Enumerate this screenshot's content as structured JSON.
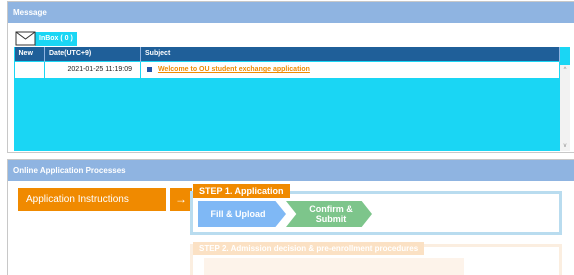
{
  "message": {
    "header": "Message",
    "inbox_label": "InBox ( 0 )",
    "columns": [
      "New",
      "Date(UTC+9)",
      "Subject"
    ],
    "rows": [
      {
        "new": "",
        "date": "2021-01-25 11:19:09",
        "subject": "Welcome to OU student exchange application"
      }
    ]
  },
  "process": {
    "header": "Online Application Processes",
    "instructions_label": "Application Instructions",
    "arrow": "→",
    "step1_label": "STEP 1. Application",
    "step1_stage1": "Fill & Upload",
    "step1_stage2_line1": "Confirm &",
    "step1_stage2_line2": "Submit",
    "step2_label": "STEP 2. Admission decision & pre-enrollment procedures"
  },
  "colors": {
    "header_bg": "#8fb4e1",
    "inbox_bg": "#1ad6f4",
    "table_header": "#1f5f99",
    "orange": "#f08a00",
    "stage_blue": "#7fb8f5",
    "stage_green": "#7dc58b"
  },
  "icons": {
    "inbox": "envelope-icon",
    "proceed": "arrow-right-icon"
  }
}
